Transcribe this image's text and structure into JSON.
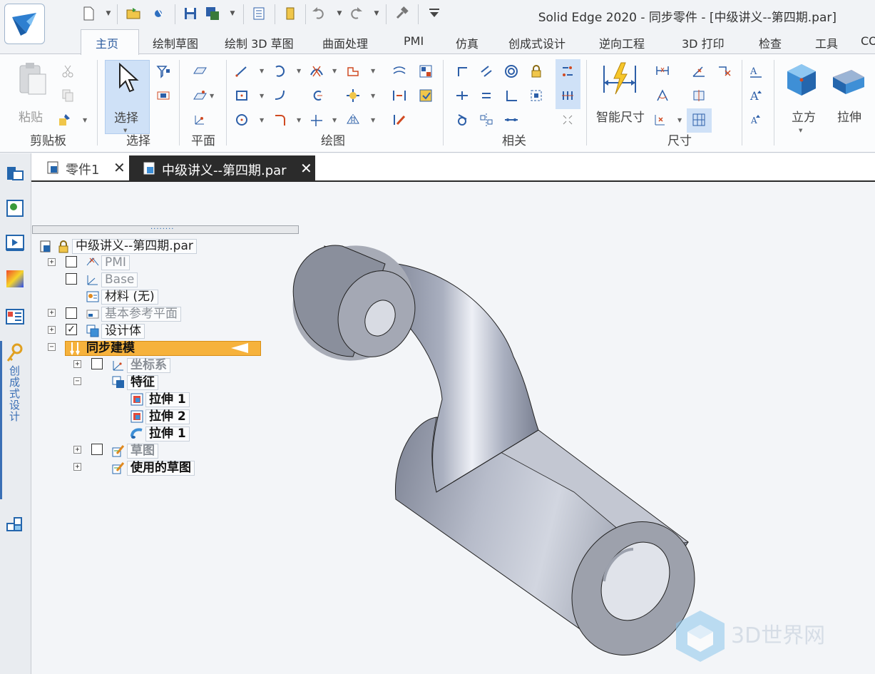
{
  "window": {
    "title": "Solid Edge 2020 - 同步零件 - [中级讲义--第四期.par]"
  },
  "quick_access": {
    "icons": [
      "new-icon",
      "open-icon",
      "print-icon",
      "save-icon",
      "save-as-icon",
      "properties-icon",
      "clipboard-icon",
      "undo-icon",
      "redo-icon",
      "hammer-icon",
      "customize-icon"
    ]
  },
  "menu_tabs": [
    "主页",
    "绘制草图",
    "绘制 3D 草图",
    "曲面处理",
    "PMI",
    "仿真",
    "创成式设计",
    "逆向工程",
    "3D 打印",
    "检查",
    "工具",
    "COM"
  ],
  "ribbon": {
    "groups": {
      "clipboard": "剪贴板",
      "select": "选择",
      "plane": "平面",
      "draw": "绘图",
      "relate": "相关",
      "dimension": "尺寸"
    },
    "buttons": {
      "paste": "粘贴",
      "select": "选择",
      "smart_dimension": "智能尺寸",
      "cube": "立方",
      "extrude": "拉伸"
    },
    "accent_color": "#cfe1f7"
  },
  "left_panel": {
    "vertical_label": "创成式设计",
    "icons": [
      "path-finder-icon",
      "feature-library-icon",
      "sensors-icon",
      "heatmap-icon",
      "layers-icon",
      "key-icon",
      "assembly-icon"
    ]
  },
  "document_tabs": [
    {
      "label": "零件1",
      "active": false
    },
    {
      "label": "中级讲义--第四期.par",
      "active": true
    }
  ],
  "tree": {
    "splitter_grip": "........",
    "root": "中级讲义--第四期.par",
    "nodes": {
      "pmi": "PMI",
      "base": "Base",
      "material": "材料 (无)",
      "ref_planes": "基本参考平面",
      "design_body": "设计体",
      "sync_model": "同步建模",
      "coord_sys": "坐标系",
      "features": "特征",
      "extrude1": "拉伸 1",
      "extrude2": "拉伸 2",
      "sweep1": "拉伸 1",
      "sketches": "草图",
      "used_sketches": "使用的草图"
    },
    "expand_plus": "+",
    "expand_minus": "−",
    "check": "✓",
    "sync_highlight": "#f6b23c"
  },
  "watermark": {
    "text": "3D世界网"
  }
}
